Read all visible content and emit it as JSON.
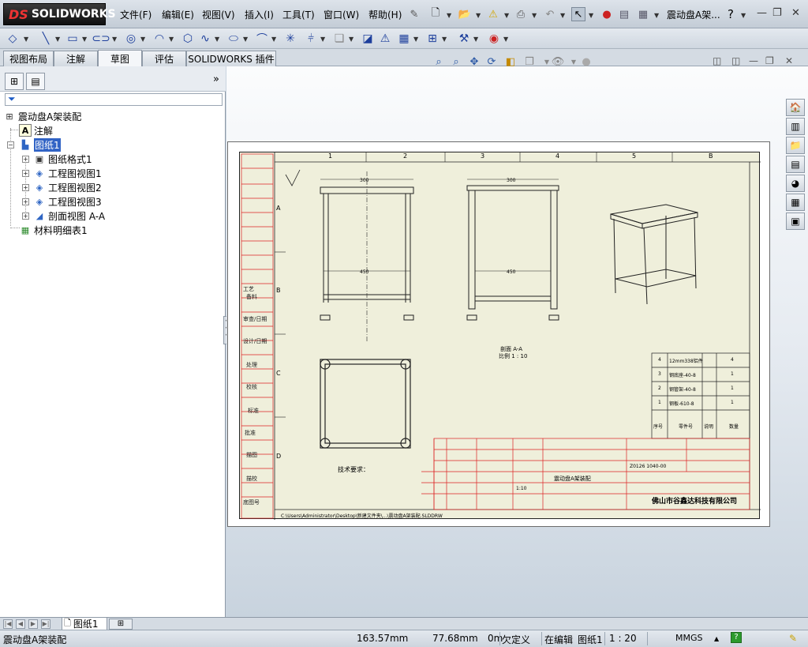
{
  "app": {
    "logo_brand": "SOLIDWORKS",
    "logo_ds": "DS",
    "document_title": "震动盘A架..."
  },
  "menu": {
    "items": [
      "文件(F)",
      "编辑(E)",
      "视图(V)",
      "插入(I)",
      "工具(T)",
      "窗口(W)",
      "帮助(H)"
    ]
  },
  "command_tabs": [
    "视图布局",
    "注解",
    "草图",
    "评估",
    "SOLIDWORKS 插件"
  ],
  "active_command_tab": "草图",
  "feature_tree": {
    "root": "震动盘A架装配",
    "annotations": "注解",
    "sheet": "图纸1",
    "children": [
      "图纸格式1",
      "工程图视图1",
      "工程图视图2",
      "工程图视图3",
      "剖面视图 A-A"
    ],
    "bom": "材料明细表1"
  },
  "drawing": {
    "zone_columns": [
      "1",
      "2",
      "3",
      "4",
      "5",
      "B"
    ],
    "zone_rows": [
      "A",
      "B",
      "C",
      "D"
    ],
    "tech_requirements": "技术要求：",
    "section_label": "剖面 A-A",
    "section_scale": "比例 1 : 10",
    "dim_300": "300",
    "dim_450": "450",
    "company": "佛山市谷鑫达科技有限公司",
    "drawing_title": "震动盘A架装配",
    "scale_value": "1:10",
    "part_no": "Z0126 1040-00",
    "file_path": "C:\\Users\\Administrator\\Desktop\\新建文件夹\\...\\震动盘A架装配.SLDDRW",
    "left_block_labels": [
      "工艺",
      "备料",
      "审查/日期",
      "设计/日期",
      "处理",
      "校核",
      "标准",
      "批准",
      "描图",
      "描校",
      "底图号"
    ],
    "bom_rows": [
      {
        "no": "4",
        "name": "12mm338铝件",
        "qty": "4"
      },
      {
        "no": "3",
        "name": "钢底座-40-8",
        "qty": "1"
      },
      {
        "no": "2",
        "name": "钢管架-40-8",
        "qty": "1"
      },
      {
        "no": "1",
        "name": "钢板-610-8",
        "qty": "1"
      }
    ],
    "bom_header": [
      "序号",
      "零件号",
      "说明",
      "数量"
    ]
  },
  "sheet_tab": "图纸1",
  "status": {
    "doc_name": "震动盘A架装配",
    "x": "163.57mm",
    "y": "77.68mm",
    "z": "0m",
    "defined": "欠定义",
    "editing": "在编辑",
    "sheet": "图纸1",
    "scale": "1 : 20",
    "units": "MMGS",
    "help": "?"
  }
}
